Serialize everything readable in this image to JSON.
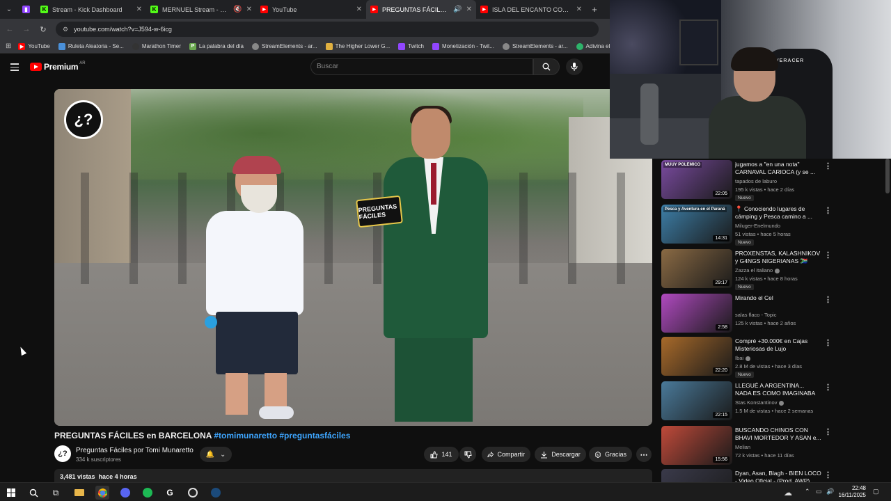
{
  "tabs": [
    {
      "label": "",
      "icon": "twitch-icon",
      "color": "#9146ff"
    },
    {
      "label": "Stream - Kick Dashboard",
      "icon": "kick-icon",
      "color": "#53fc18"
    },
    {
      "label": "MERNUEL Stream - Watch Li",
      "icon": "kick-icon",
      "color": "#53fc18"
    },
    {
      "label": "YouTube",
      "icon": "youtube-icon",
      "color": "#ff0000"
    },
    {
      "label": "PREGUNTAS FÁCILES en BAR",
      "icon": "youtube-icon",
      "color": "#ff0000"
    },
    {
      "label": "ISLA DEL ENCANTO CON COSC",
      "icon": "youtube-icon",
      "color": "#ff0000"
    }
  ],
  "url": "youtube.com/watch?v=J594-w-6icg",
  "bookmarks": [
    {
      "label": "YouTube",
      "color": "#ff0000"
    },
    {
      "label": "Ruleta Aleatoria - Se...",
      "color": "#4a90d9"
    },
    {
      "label": "Marathon Timer",
      "color": "#333"
    },
    {
      "label": "La palabra del día",
      "color": "#6aa84f"
    },
    {
      "label": "StreamElements - ar...",
      "color": "#888"
    },
    {
      "label": "The Higher Lower G...",
      "color": "#e0b040"
    },
    {
      "label": "Twitch",
      "color": "#9146ff"
    },
    {
      "label": "Monetización - Twit...",
      "color": "#9146ff"
    },
    {
      "label": "StreamElements - ar...",
      "color": "#888"
    },
    {
      "label": "Adivina el",
      "color": "#2db36a"
    }
  ],
  "youtube": {
    "logo_text": "Premium",
    "country": "AR",
    "search_placeholder": "Buscar"
  },
  "video": {
    "title_main": "PREGUNTAS FÁCILES en BARCELONA",
    "title_tags": "#tomimunaretto #preguntasfáciles",
    "mic_sign": "PREGUNTAS FÁCILES",
    "channel_name": "Preguntas Fáciles por Tomi Munaretto",
    "subscribers": "334 k suscriptores",
    "likes": "141",
    "share_label": "Compartir",
    "download_label": "Descargar",
    "thanks_label": "Gracias",
    "views": "3,481 vistas",
    "age": "hace 4 horas"
  },
  "recommended": [
    {
      "title": "jugamos a \"en una nota\" CARNAVAL CARIOCA (y se ...",
      "channel": "tapados de laburo",
      "meta": "195 k vistas • hace 2 días",
      "duration": "22:05",
      "new": "Nuevo",
      "verified": false,
      "thumb_color": "#7a4ba0",
      "thumb_text": "MUUY POLÉMICO"
    },
    {
      "title": "📍 Conociendo lugares de cámping y Pesca camino a ...",
      "channel": "Miluger-Enelmundo",
      "meta": "51 vistas • hace 5 horas",
      "duration": "14:31",
      "new": "Nuevo",
      "verified": false,
      "thumb_color": "#3d7fa8",
      "thumb_text": "Pesca y Aventura en el Paraná"
    },
    {
      "title": "PROXENSTAS, KALASHNIKOV y G4NGS NIGERIANAS 🇿🇦",
      "channel": "Zazza el italiano",
      "meta": "124 k vistas • hace 8 horas",
      "duration": "29:17",
      "new": "Nuevo",
      "verified": true,
      "thumb_color": "#8a6a44",
      "thumb_text": ""
    },
    {
      "title": "Mirando el Cel",
      "channel": "salas flaco - Topic",
      "meta": "125 k vistas • hace 2 años",
      "duration": "2:58",
      "new": "",
      "verified": false,
      "thumb_color": "#b04ac0",
      "thumb_text": ""
    },
    {
      "title": "Compré +30.000€ en Cajas Misteriosas de Lujo",
      "channel": "Ibai",
      "meta": "2.8 M de vistas • hace 3 días",
      "duration": "22:20",
      "new": "Nuevo",
      "verified": true,
      "thumb_color": "#a86a2a",
      "thumb_text": ""
    },
    {
      "title": "LLEGUÉ A ARGENTINA... NADA ES COMO IMAGINABA",
      "channel": "Stas Konstantinov",
      "meta": "1.5 M de vistas • hace 2 semanas",
      "duration": "22:15",
      "new": "",
      "verified": true,
      "thumb_color": "#4a7a9a",
      "thumb_text": ""
    },
    {
      "title": "BUSCANDO CHINOS CON BHAVI MORTEDOR Y ASAN e...",
      "channel": "Melian",
      "meta": "72 k vistas • hace 11 días",
      "duration": "15:56",
      "new": "",
      "verified": false,
      "thumb_color": "#c04a3a",
      "thumb_text": ""
    },
    {
      "title": "Dyan, Asan, Blagh - BIEN LOCO - Video Oficial - (Prod. AWP)",
      "channel": "",
      "meta": "",
      "duration": "",
      "new": "",
      "verified": false,
      "thumb_color": "#3a3a4a",
      "thumb_text": ""
    }
  ],
  "cam": {
    "chair_text": "VERACER"
  },
  "taskbar": {
    "time": "22:48",
    "date": "16/11/2025"
  }
}
